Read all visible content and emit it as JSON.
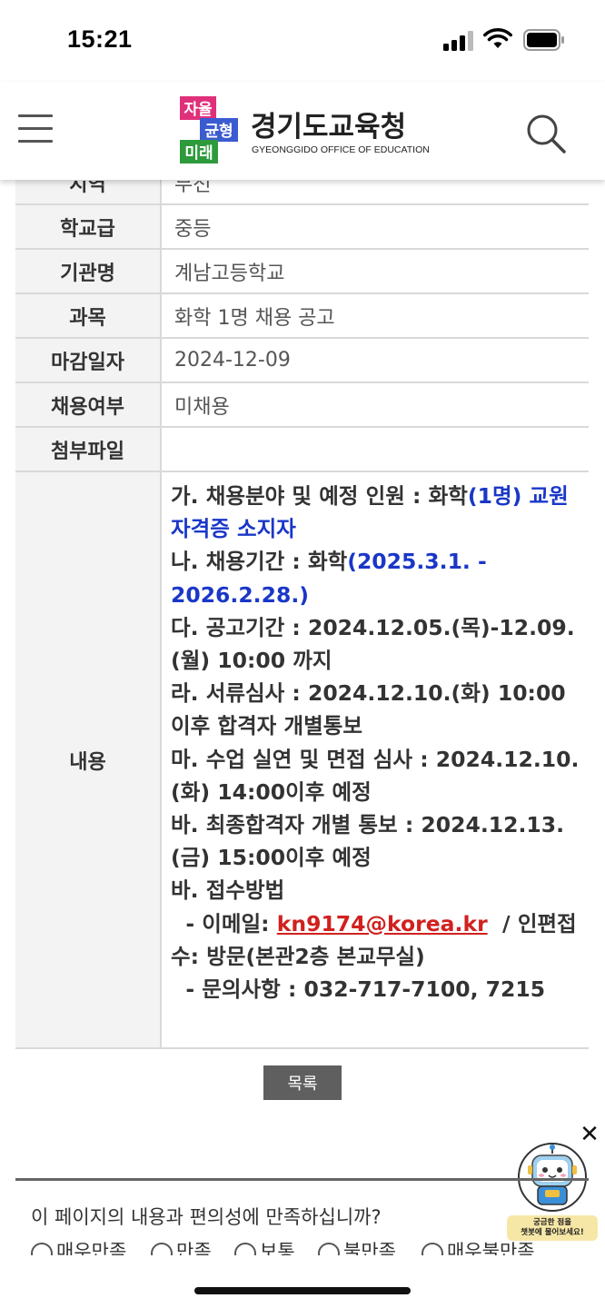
{
  "status": {
    "time": "15:21"
  },
  "header": {
    "logo_badge_1": "자율",
    "logo_badge_2": "균형",
    "logo_badge_3": "미래",
    "logo_title": "경기도교육청",
    "logo_subtitle": "GYEONGGIDO OFFICE OF EDUCATION",
    "colors": {
      "badge_pink": "#e0307a",
      "badge_blue": "#3b5bd1",
      "badge_green": "#2e9a3c"
    }
  },
  "table": {
    "clipped_label": "지역",
    "clipped_value": "부천",
    "rows": [
      {
        "label": "학교급",
        "value": "중등"
      },
      {
        "label": "기관명",
        "value": "계남고등학교"
      },
      {
        "label": "과목",
        "value": "화학 1명 채용 공고"
      },
      {
        "label": "마감일자",
        "value": "2024-12-09"
      },
      {
        "label": "채용여부",
        "value": "미채용"
      },
      {
        "label": "첨부파일",
        "value": ""
      }
    ],
    "content_label": "내용",
    "content": {
      "line1a": "가. 채용분야 및 예정 인원 : 화학",
      "line1b": "(1명) 교원자격증 소지자",
      "line2a": "나. 채용기간 : 화학",
      "line2b": "(2025.3.1. - 2026.2.28.)",
      "line3": "다. 공고기간 : 2024.12.05.(목)-12.09.(월) 10:00 까지",
      "line4": "라. 서류심사 : 2024.12.10.(화) 10:00 이후 합격자 개별통보",
      "line5": "마. 수업 실연 및 면접 심사 : 2024.12.10.(화) 14:00이후 예정",
      "line6": "바. 최종합격자 개별 통보 : 2024.12.13.(금) 15:00이후 예정",
      "line7": "바. 접수방법",
      "email_prefix": "  - 이메일: ",
      "email": "kn9174@korea.kr",
      "email_suffix": "  / 인편접수: 방문(본관2층 본교무실)",
      "line9": "  - 문의사항 : 032-717-7100, 7215"
    }
  },
  "list_button": "목록",
  "chatbot": {
    "label_line1": "궁금한 점을",
    "label_line2": "챗봇에 물어보세요!"
  },
  "survey": {
    "question": "이 페이지의 내용과 편의성에 만족하십니까?",
    "options": [
      "매우만족",
      "만족",
      "보통",
      "불만족",
      "매우불만족"
    ]
  }
}
